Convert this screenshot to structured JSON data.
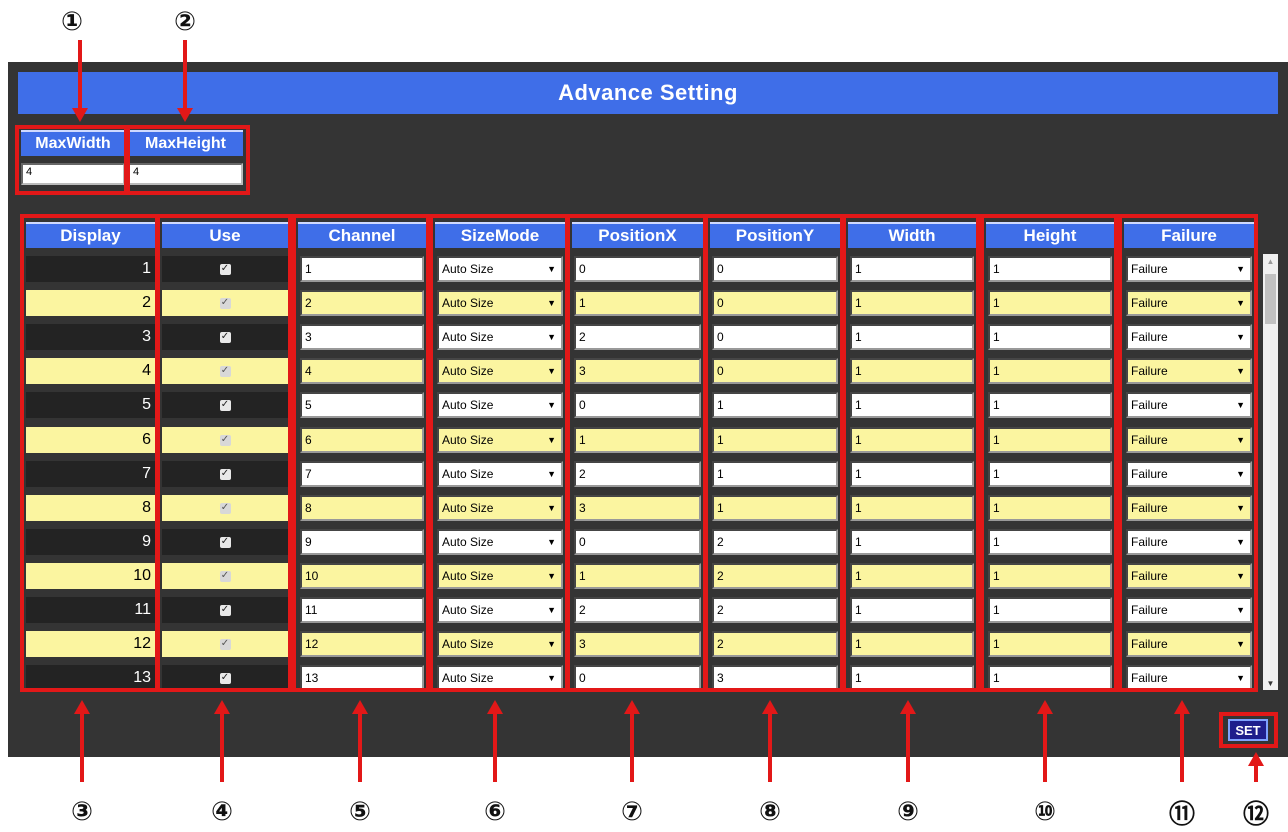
{
  "title": "Advance Setting",
  "max": {
    "width_label": "MaxWidth",
    "width_value": "4",
    "height_label": "MaxHeight",
    "height_value": "4"
  },
  "columns": [
    "Display",
    "Use",
    "Channel",
    "SizeMode",
    "PositionX",
    "PositionY",
    "Width",
    "Height",
    "Failure"
  ],
  "rows": [
    {
      "display": "1",
      "use": true,
      "channel": "1",
      "sizemode": "Auto Size",
      "posx": "0",
      "posy": "0",
      "width": "1",
      "height": "1",
      "failure": "Failure"
    },
    {
      "display": "2",
      "use": true,
      "channel": "2",
      "sizemode": "Auto Size",
      "posx": "1",
      "posy": "0",
      "width": "1",
      "height": "1",
      "failure": "Failure"
    },
    {
      "display": "3",
      "use": true,
      "channel": "3",
      "sizemode": "Auto Size",
      "posx": "2",
      "posy": "0",
      "width": "1",
      "height": "1",
      "failure": "Failure"
    },
    {
      "display": "4",
      "use": true,
      "channel": "4",
      "sizemode": "Auto Size",
      "posx": "3",
      "posy": "0",
      "width": "1",
      "height": "1",
      "failure": "Failure"
    },
    {
      "display": "5",
      "use": true,
      "channel": "5",
      "sizemode": "Auto Size",
      "posx": "0",
      "posy": "1",
      "width": "1",
      "height": "1",
      "failure": "Failure"
    },
    {
      "display": "6",
      "use": true,
      "channel": "6",
      "sizemode": "Auto Size",
      "posx": "1",
      "posy": "1",
      "width": "1",
      "height": "1",
      "failure": "Failure"
    },
    {
      "display": "7",
      "use": true,
      "channel": "7",
      "sizemode": "Auto Size",
      "posx": "2",
      "posy": "1",
      "width": "1",
      "height": "1",
      "failure": "Failure"
    },
    {
      "display": "8",
      "use": true,
      "channel": "8",
      "sizemode": "Auto Size",
      "posx": "3",
      "posy": "1",
      "width": "1",
      "height": "1",
      "failure": "Failure"
    },
    {
      "display": "9",
      "use": true,
      "channel": "9",
      "sizemode": "Auto Size",
      "posx": "0",
      "posy": "2",
      "width": "1",
      "height": "1",
      "failure": "Failure"
    },
    {
      "display": "10",
      "use": true,
      "channel": "10",
      "sizemode": "Auto Size",
      "posx": "1",
      "posy": "2",
      "width": "1",
      "height": "1",
      "failure": "Failure"
    },
    {
      "display": "11",
      "use": true,
      "channel": "11",
      "sizemode": "Auto Size",
      "posx": "2",
      "posy": "2",
      "width": "1",
      "height": "1",
      "failure": "Failure"
    },
    {
      "display": "12",
      "use": true,
      "channel": "12",
      "sizemode": "Auto Size",
      "posx": "3",
      "posy": "2",
      "width": "1",
      "height": "1",
      "failure": "Failure"
    },
    {
      "display": "13",
      "use": true,
      "channel": "13",
      "sizemode": "Auto Size",
      "posx": "0",
      "posy": "3",
      "width": "1",
      "height": "1",
      "failure": "Failure"
    }
  ],
  "set_label": "SET",
  "markers": [
    "①",
    "②",
    "③",
    "④",
    "⑤",
    "⑥",
    "⑦",
    "⑧",
    "⑨",
    "⑩",
    "⑪",
    "⑫"
  ],
  "colors": {
    "header_blue": "#3f6ee8",
    "highlight_yellow": "#fbf5a0",
    "annotation_red": "#e21818",
    "panel_bg": "#343434"
  }
}
